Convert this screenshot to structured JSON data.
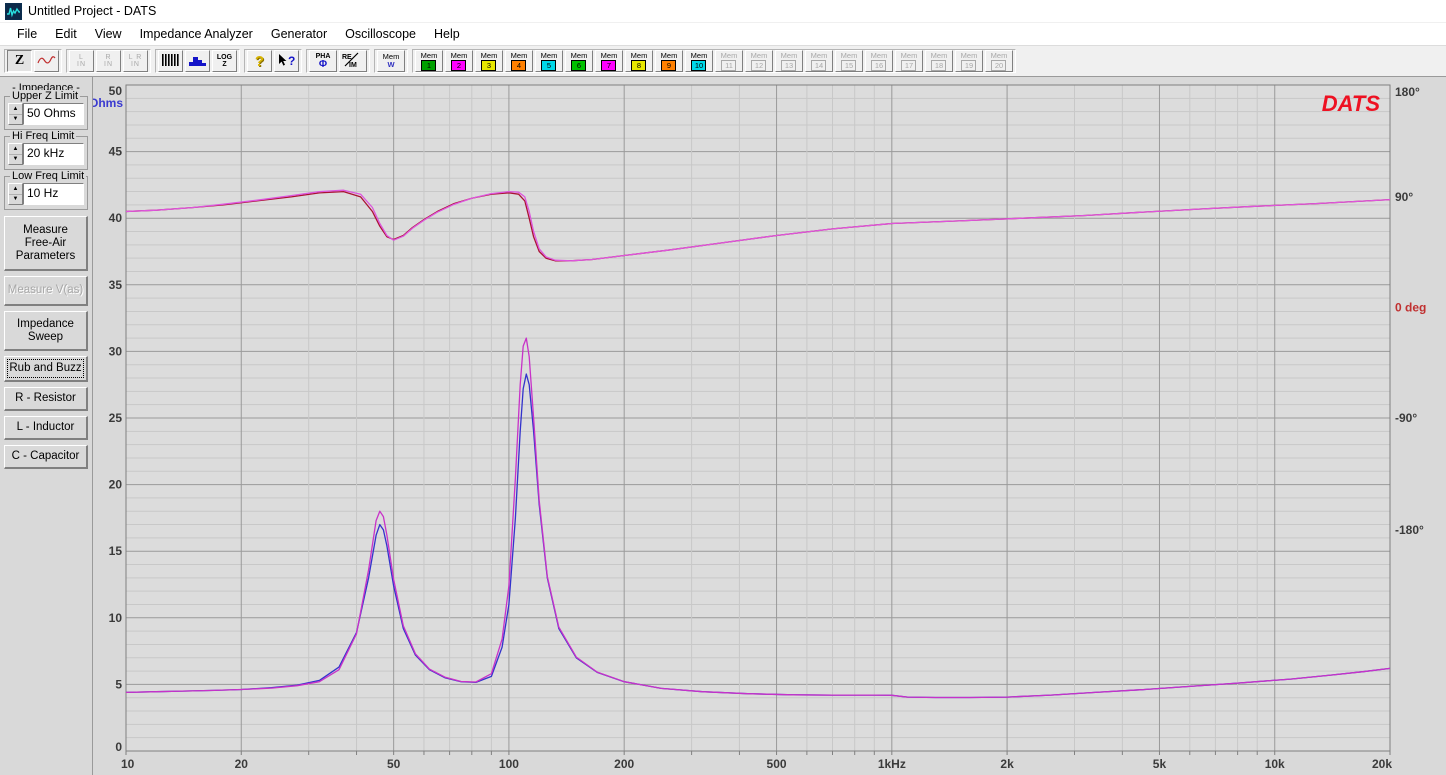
{
  "window": {
    "title": "Untitled Project - DATS",
    "icon": "dats-waveform-icon"
  },
  "menu": {
    "items": [
      "File",
      "Edit",
      "View",
      "Impedance Analyzer",
      "Generator",
      "Oscilloscope",
      "Help"
    ]
  },
  "toolbar": {
    "groups": [
      {
        "name": "display-mode",
        "buttons": [
          {
            "name": "impedance-z-button",
            "label": "Z",
            "kind": "z",
            "state": "pressed"
          },
          {
            "name": "sine-wave-button",
            "label": "",
            "kind": "sine",
            "state": "normal"
          }
        ]
      },
      {
        "name": "input-channels",
        "buttons": [
          {
            "name": "left-in-button",
            "label": "L\nIN",
            "kind": "lin",
            "top": "L",
            "bottom": "IN",
            "state": "disabled"
          },
          {
            "name": "right-in-button",
            "label": "R\nIN",
            "kind": "lin",
            "top": "R",
            "bottom": "IN",
            "state": "disabled"
          },
          {
            "name": "left-right-in-button",
            "label": "L R\nIN",
            "kind": "lin",
            "top": "L R",
            "bottom": "IN",
            "state": "disabled"
          }
        ]
      },
      {
        "name": "graph-type",
        "buttons": [
          {
            "name": "bar-graph-button",
            "kind": "bars",
            "state": "normal"
          },
          {
            "name": "filled-graph-button",
            "kind": "filled",
            "state": "normal"
          },
          {
            "name": "log-z-button",
            "kind": "logz",
            "top": "LOG",
            "bottom": "Z",
            "state": "normal"
          }
        ]
      },
      {
        "name": "help-tools",
        "buttons": [
          {
            "name": "help-question-button",
            "kind": "question",
            "state": "normal"
          },
          {
            "name": "context-help-button",
            "kind": "arrowhelp",
            "state": "normal"
          }
        ]
      },
      {
        "name": "phase-reim",
        "buttons": [
          {
            "name": "phase-button",
            "kind": "pha",
            "top": "PHA",
            "state": "normal"
          },
          {
            "name": "re-im-button",
            "kind": "reim",
            "top": "RE",
            "bottom": "IM",
            "state": "normal"
          }
        ]
      },
      {
        "name": "memory-w",
        "buttons": [
          {
            "name": "memory-w-button",
            "kind": "memw",
            "label": "Mem",
            "num": "W",
            "color": "#3030c0",
            "state": "normal"
          }
        ]
      },
      {
        "name": "memory-slots",
        "buttons": [
          {
            "name": "memory-1-button",
            "label": "Mem",
            "num": "1",
            "color": "#00a000",
            "state": "normal"
          },
          {
            "name": "memory-2-button",
            "label": "Mem",
            "num": "2",
            "color": "#ff00ff",
            "state": "normal"
          },
          {
            "name": "memory-3-button",
            "label": "Mem",
            "num": "3",
            "color": "#e8e800",
            "state": "normal"
          },
          {
            "name": "memory-4-button",
            "label": "Mem",
            "num": "4",
            "color": "#ff8000",
            "state": "normal"
          },
          {
            "name": "memory-5-button",
            "label": "Mem",
            "num": "5",
            "color": "#00d8e8",
            "state": "normal"
          },
          {
            "name": "memory-6-button",
            "label": "Mem",
            "num": "6",
            "color": "#00c000",
            "state": "normal"
          },
          {
            "name": "memory-7-button",
            "label": "Mem",
            "num": "7",
            "color": "#ff00ff",
            "state": "normal"
          },
          {
            "name": "memory-8-button",
            "label": "Mem",
            "num": "8",
            "color": "#e8e800",
            "state": "normal"
          },
          {
            "name": "memory-9-button",
            "label": "Mem",
            "num": "9",
            "color": "#ff8000",
            "state": "normal"
          },
          {
            "name": "memory-10-button",
            "label": "Mem",
            "num": "10",
            "color": "#00d8e8",
            "state": "normal"
          },
          {
            "name": "memory-11-button",
            "label": "Mem",
            "num": "11",
            "color": "#a8a8a8",
            "state": "disabled"
          },
          {
            "name": "memory-12-button",
            "label": "Mem",
            "num": "12",
            "color": "#a8a8a8",
            "state": "disabled"
          },
          {
            "name": "memory-13-button",
            "label": "Mem",
            "num": "13",
            "color": "#a8a8a8",
            "state": "disabled"
          },
          {
            "name": "memory-14-button",
            "label": "Mem",
            "num": "14",
            "color": "#a8a8a8",
            "state": "disabled"
          },
          {
            "name": "memory-15-button",
            "label": "Mem",
            "num": "15",
            "color": "#a8a8a8",
            "state": "disabled"
          },
          {
            "name": "memory-16-button",
            "label": "Mem",
            "num": "16",
            "color": "#a8a8a8",
            "state": "disabled"
          },
          {
            "name": "memory-17-button",
            "label": "Mem",
            "num": "17",
            "color": "#a8a8a8",
            "state": "disabled"
          },
          {
            "name": "memory-18-button",
            "label": "Mem",
            "num": "18",
            "color": "#a8a8a8",
            "state": "disabled"
          },
          {
            "name": "memory-19-button",
            "label": "Mem",
            "num": "19",
            "color": "#a8a8a8",
            "state": "disabled"
          },
          {
            "name": "memory-20-button",
            "label": "Mem",
            "num": "20",
            "color": "#a8a8a8",
            "state": "disabled"
          }
        ]
      }
    ]
  },
  "sidebar": {
    "title": "- Impedance -",
    "fields": [
      {
        "name": "upper-z-limit",
        "legend": "Upper Z Limit",
        "value": "50 Ohms"
      },
      {
        "name": "hi-freq-limit",
        "legend": "Hi Freq Limit",
        "value": "20 kHz"
      },
      {
        "name": "low-freq-limit",
        "legend": "Low Freq Limit",
        "value": "10 Hz"
      }
    ],
    "buttons": [
      {
        "name": "measure-free-air-parameters-button",
        "label": "Measure\nFree-Air\nParameters",
        "state": "normal"
      },
      {
        "name": "measure-vas-button",
        "label": "Measure V(as)",
        "state": "disabled"
      },
      {
        "name": "impedance-sweep-button",
        "label": "Impedance\nSweep",
        "state": "normal"
      },
      {
        "name": "rub-and-buzz-button",
        "label": "Rub and Buzz",
        "state": "focused"
      },
      {
        "name": "r-resistor-button",
        "label": "R - Resistor",
        "state": "normal"
      },
      {
        "name": "l-inductor-button",
        "label": "L - Inductor",
        "state": "normal"
      },
      {
        "name": "c-capacitor-button",
        "label": "C - Capacitor",
        "state": "normal"
      }
    ]
  },
  "plot": {
    "logo": "DATS",
    "left_axis_unit": "Ohms",
    "right_axis_unit": "0 deg"
  },
  "chart_data": {
    "type": "line",
    "title": "",
    "xlabel": "",
    "ylabel": "Ohms",
    "y2label": "deg",
    "xscale": "log",
    "xlim": [
      10,
      20000
    ],
    "ylim": [
      0,
      50
    ],
    "y2lim": [
      -360,
      180
    ],
    "grid": true,
    "legend": "none",
    "xticks": [
      10,
      20,
      50,
      100,
      200,
      500,
      1000,
      2000,
      5000,
      10000,
      20000
    ],
    "xticklabels": [
      "10",
      "20",
      "50",
      "100",
      "200",
      "500",
      "1kHz",
      "2k",
      "5k",
      "10k",
      "20k"
    ],
    "yticks": [
      0,
      5,
      10,
      15,
      20,
      25,
      30,
      35,
      40,
      45,
      50
    ],
    "yticklabels": [
      "0",
      "5",
      "10",
      "15",
      "20",
      "25",
      "30",
      "35",
      "40",
      "45",
      "50"
    ],
    "y2ticks": [
      180,
      90,
      0,
      -90,
      -180
    ],
    "y2ticklabels": [
      "180°",
      "90°",
      "0 deg",
      "-90°",
      "-180°"
    ],
    "minor_y_step": 1,
    "series": [
      {
        "name": "impedance-magnitude-blue",
        "color": "#3333cc",
        "axis": "left",
        "x": [
          10,
          12,
          14,
          17,
          20,
          24,
          28,
          32,
          36,
          40,
          43,
          45,
          46,
          47,
          48,
          50,
          53,
          57,
          62,
          68,
          75,
          82,
          90,
          96,
          100,
          104,
          107,
          109,
          111,
          113,
          116,
          120,
          126,
          135,
          150,
          170,
          200,
          250,
          320,
          420,
          550,
          700,
          900,
          1000,
          1100,
          1300,
          1600,
          2000,
          2600,
          3400,
          4500,
          6000,
          8000,
          11000,
          14000,
          17000,
          20000
        ],
        "values": [
          4.4,
          4.45,
          4.5,
          4.55,
          4.62,
          4.75,
          4.95,
          5.3,
          6.3,
          8.9,
          13.0,
          16.2,
          17.0,
          16.6,
          15.4,
          12.4,
          9.2,
          7.2,
          6.1,
          5.5,
          5.2,
          5.15,
          5.6,
          7.8,
          11.0,
          17.5,
          24.0,
          27.2,
          28.3,
          27.5,
          24.0,
          18.5,
          13.0,
          9.2,
          7.0,
          5.9,
          5.2,
          4.7,
          4.45,
          4.3,
          4.22,
          4.2,
          4.2,
          4.18,
          4.05,
          4.02,
          4.02,
          4.05,
          4.2,
          4.4,
          4.6,
          4.85,
          5.1,
          5.4,
          5.7,
          5.95,
          6.2
        ]
      },
      {
        "name": "impedance-magnitude-magenta",
        "color": "#c832c8",
        "axis": "left",
        "x": [
          10,
          12,
          14,
          17,
          20,
          24,
          28,
          32,
          36,
          40,
          43,
          45,
          46,
          47,
          48,
          50,
          53,
          57,
          62,
          68,
          75,
          82,
          90,
          96,
          100,
          104,
          107,
          109,
          111,
          113,
          116,
          120,
          126,
          135,
          150,
          170,
          200,
          250,
          320,
          420,
          550,
          700,
          900,
          1000,
          1100,
          1300,
          1600,
          2000,
          2600,
          3400,
          4500,
          6000,
          8000,
          11000,
          14000,
          17000,
          20000
        ],
        "values": [
          4.4,
          4.45,
          4.5,
          4.55,
          4.62,
          4.72,
          4.9,
          5.2,
          6.1,
          8.8,
          13.6,
          17.3,
          18.0,
          17.6,
          16.2,
          12.9,
          9.4,
          7.3,
          6.15,
          5.55,
          5.22,
          5.18,
          5.8,
          8.4,
          12.4,
          20.5,
          27.5,
          30.4,
          31.0,
          29.6,
          25.0,
          18.8,
          13.1,
          9.3,
          7.05,
          5.92,
          5.2,
          4.7,
          4.45,
          4.3,
          4.22,
          4.2,
          4.2,
          4.18,
          4.05,
          4.02,
          4.02,
          4.05,
          4.2,
          4.4,
          4.6,
          4.85,
          5.1,
          5.4,
          5.7,
          5.95,
          6.2
        ]
      },
      {
        "name": "phase-dark-red",
        "color": "#aa1133",
        "axis": "left_overlay",
        "x": [
          10,
          12,
          15,
          18,
          22,
          27,
          32,
          37,
          41,
          44,
          46,
          48,
          50,
          53,
          56,
          60,
          65,
          72,
          80,
          90,
          100,
          106,
          110,
          113,
          116,
          120,
          125,
          132,
          145,
          165,
          200,
          260,
          350,
          500,
          700,
          1000,
          1500,
          2200,
          3200,
          4500,
          6500,
          9000,
          13000,
          16000,
          20000
        ],
        "values": [
          40.5,
          40.6,
          40.8,
          41.0,
          41.3,
          41.6,
          41.9,
          42.0,
          41.6,
          40.5,
          39.4,
          38.6,
          38.4,
          38.7,
          39.3,
          39.9,
          40.5,
          41.1,
          41.5,
          41.8,
          41.9,
          41.8,
          41.3,
          40.0,
          38.6,
          37.5,
          37.0,
          36.8,
          36.8,
          36.9,
          37.2,
          37.6,
          38.1,
          38.7,
          39.2,
          39.6,
          39.8,
          40.0,
          40.2,
          40.45,
          40.7,
          40.9,
          41.1,
          41.25,
          41.4
        ]
      },
      {
        "name": "phase-magenta",
        "color": "#dd55dd",
        "axis": "left_overlay",
        "x": [
          10,
          12,
          15,
          18,
          22,
          27,
          32,
          37,
          41,
          44,
          46,
          48,
          50,
          53,
          56,
          60,
          65,
          72,
          80,
          90,
          100,
          106,
          110,
          113,
          116,
          120,
          125,
          132,
          145,
          165,
          200,
          260,
          350,
          500,
          700,
          1000,
          1500,
          2200,
          3200,
          4500,
          6500,
          9000,
          13000,
          16000,
          20000
        ],
        "values": [
          40.5,
          40.6,
          40.8,
          41.05,
          41.35,
          41.7,
          42.0,
          42.1,
          41.8,
          40.8,
          39.6,
          38.7,
          38.35,
          38.65,
          39.25,
          39.85,
          40.45,
          41.05,
          41.5,
          41.85,
          42.0,
          41.95,
          41.6,
          40.5,
          39.0,
          37.7,
          37.1,
          36.85,
          36.8,
          36.9,
          37.2,
          37.6,
          38.1,
          38.7,
          39.2,
          39.6,
          39.8,
          40.0,
          40.2,
          40.45,
          40.7,
          40.9,
          41.1,
          41.25,
          41.4
        ]
      }
    ]
  }
}
